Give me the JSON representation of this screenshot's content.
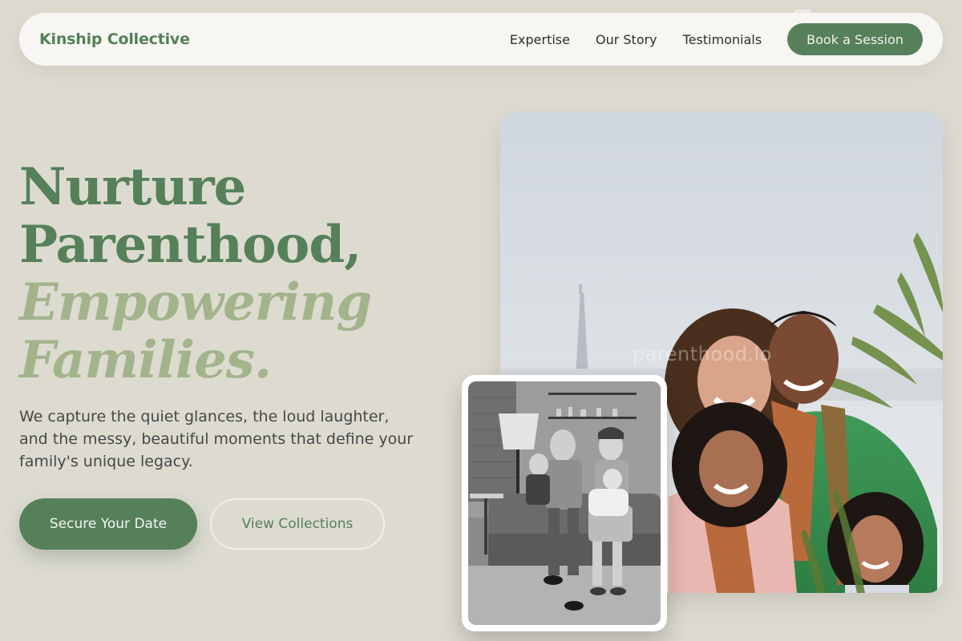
{
  "nav": {
    "brand": "Kinship Collective",
    "links": [
      {
        "label": "Expertise"
      },
      {
        "label": "Our Story"
      },
      {
        "label": "Testimonials"
      }
    ],
    "cta": "Book a Session"
  },
  "hero": {
    "title_line1": "Nurture",
    "title_line2": "Parenthood,",
    "title_line3": "Empowering",
    "title_line4": "Families.",
    "description": "We capture the quiet glances, the loud laughter, and the messy, beautiful moments that define your family's unique legacy.",
    "primary_button": "Secure Your Date",
    "secondary_button": "View Collections"
  },
  "photo": {
    "watermark": "parenthood.lo"
  },
  "colors": {
    "background": "#dddbd0",
    "accent_green": "#55805a",
    "accent_sage": "#a3b38c",
    "nav_bg": "#f7f6f3"
  }
}
